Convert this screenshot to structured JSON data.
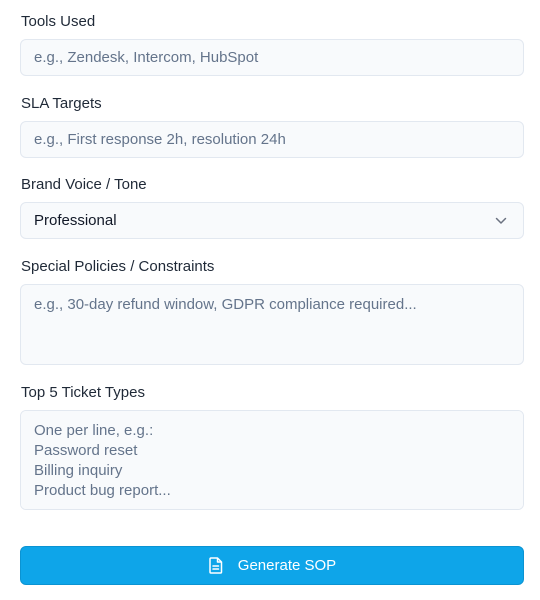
{
  "form": {
    "tools": {
      "label": "Tools Used",
      "placeholder": "e.g., Zendesk, Intercom, HubSpot",
      "value": ""
    },
    "sla": {
      "label": "SLA Targets",
      "placeholder": "e.g., First response 2h, resolution 24h",
      "value": ""
    },
    "brand_voice": {
      "label": "Brand Voice / Tone",
      "selected": "Professional",
      "icon": "chevron-down-icon"
    },
    "policies": {
      "label": "Special Policies / Constraints",
      "placeholder": "e.g., 30-day refund window, GDPR compliance required...",
      "value": ""
    },
    "ticket_types": {
      "label": "Top 5 Ticket Types",
      "placeholder": "One per line, e.g.:\nPassword reset\nBilling inquiry\nProduct bug report...",
      "value": ""
    }
  },
  "actions": {
    "generate_label": "Generate SOP",
    "generate_icon": "document-icon",
    "accent": "#0ea5e9"
  }
}
